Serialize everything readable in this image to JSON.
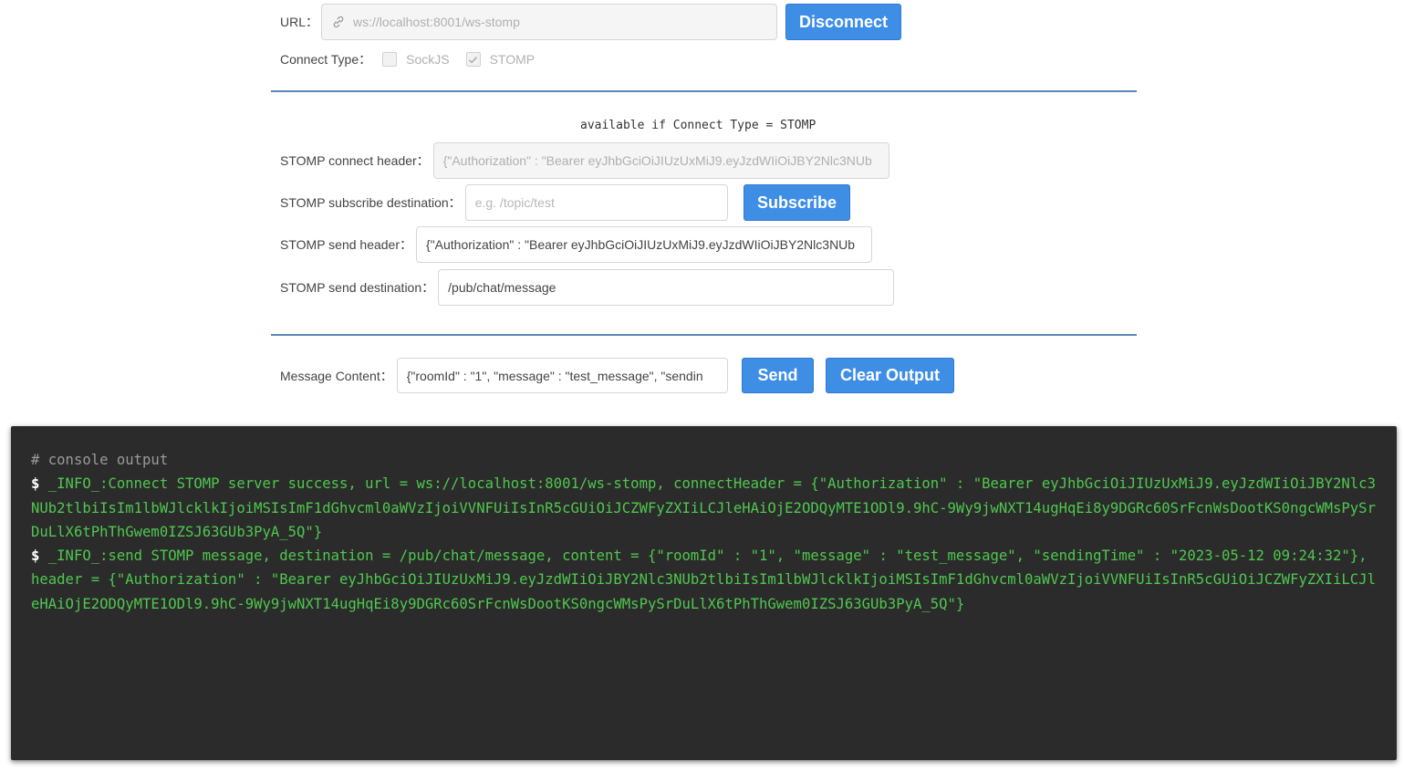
{
  "connection": {
    "url_label": "URL：",
    "url_value": "ws://localhost:8001/ws-stomp",
    "disconnect_label": "Disconnect",
    "connect_type_label": "Connect Type：",
    "options": [
      {
        "label": "SockJS",
        "checked": false
      },
      {
        "label": "STOMP",
        "checked": true
      }
    ]
  },
  "stomp": {
    "note": "available if Connect Type = STOMP",
    "connect_header_label": "STOMP connect header：",
    "connect_header_value": "{\"Authorization\" : \"Bearer eyJhbGciOiJIUzUxMiJ9.eyJzdWIiOiJBY2Nlc3NUb",
    "subscribe_destination_label": "STOMP subscribe destination：",
    "subscribe_destination_placeholder": "e.g. /topic/test",
    "subscribe_label": "Subscribe",
    "send_header_label": "STOMP send header：",
    "send_header_value": "{\"Authorization\" : \"Bearer eyJhbGciOiJIUzUxMiJ9.eyJzdWIiOiJBY2Nlc3NUb",
    "send_destination_label": "STOMP send destination：",
    "send_destination_value": "/pub/chat/message"
  },
  "message": {
    "content_label": "Message Content：",
    "content_value": "{\"roomId\" : \"1\", \"message\" : \"test_message\", \"sendin",
    "send_label": "Send",
    "clear_label": "Clear Output"
  },
  "console": {
    "comment": "# console output",
    "prompt": "$",
    "lines": [
      "_INFO_:Connect STOMP server success, url = ws://localhost:8001/ws-stomp, connectHeader = {\"Authorization\" : \"Bearer eyJhbGciOiJIUzUxMiJ9.eyJzdWIiOiJBY2Nlc3NUb2tlbiIsIm1lbWJlcklkIjoiMSIsImF1dGhvcml0aWVzIjoiVVNFUiIsInR5cGUiOiJCZWFyZXIiLCJleHAiOjE2ODQyMTE1ODl9.9hC-9Wy9jwNXT14ugHqEi8y9DGRc60SrFcnWsDootKS0ngcWMsPySrDuLlX6tPhThGwem0IZSJ63GUb3PyA_5Q\"}",
      "_INFO_:send STOMP message, destination = /pub/chat/message, content = {\"roomId\" : \"1\", \"message\" : \"test_message\", \"sendingTime\" : \"2023-05-12 09:24:32\"}, header = {\"Authorization\" : \"Bearer eyJhbGciOiJIUzUxMiJ9.eyJzdWIiOiJBY2Nlc3NUb2tlbiIsIm1lbWJlcklkIjoiMSIsImF1dGhvcml0aWVzIjoiVVNFUiIsInR5cGUiOiJCZWFyZXIiLCJleHAiOjE2ODQyMTE1ODl9.9hC-9Wy9jwNXT14ugHqEi8y9DGRc60SrFcnWsDootKS0ngcWMsPySrDuLlX6tPhThGwem0IZSJ63GUb3PyA_5Q\"}"
    ]
  }
}
